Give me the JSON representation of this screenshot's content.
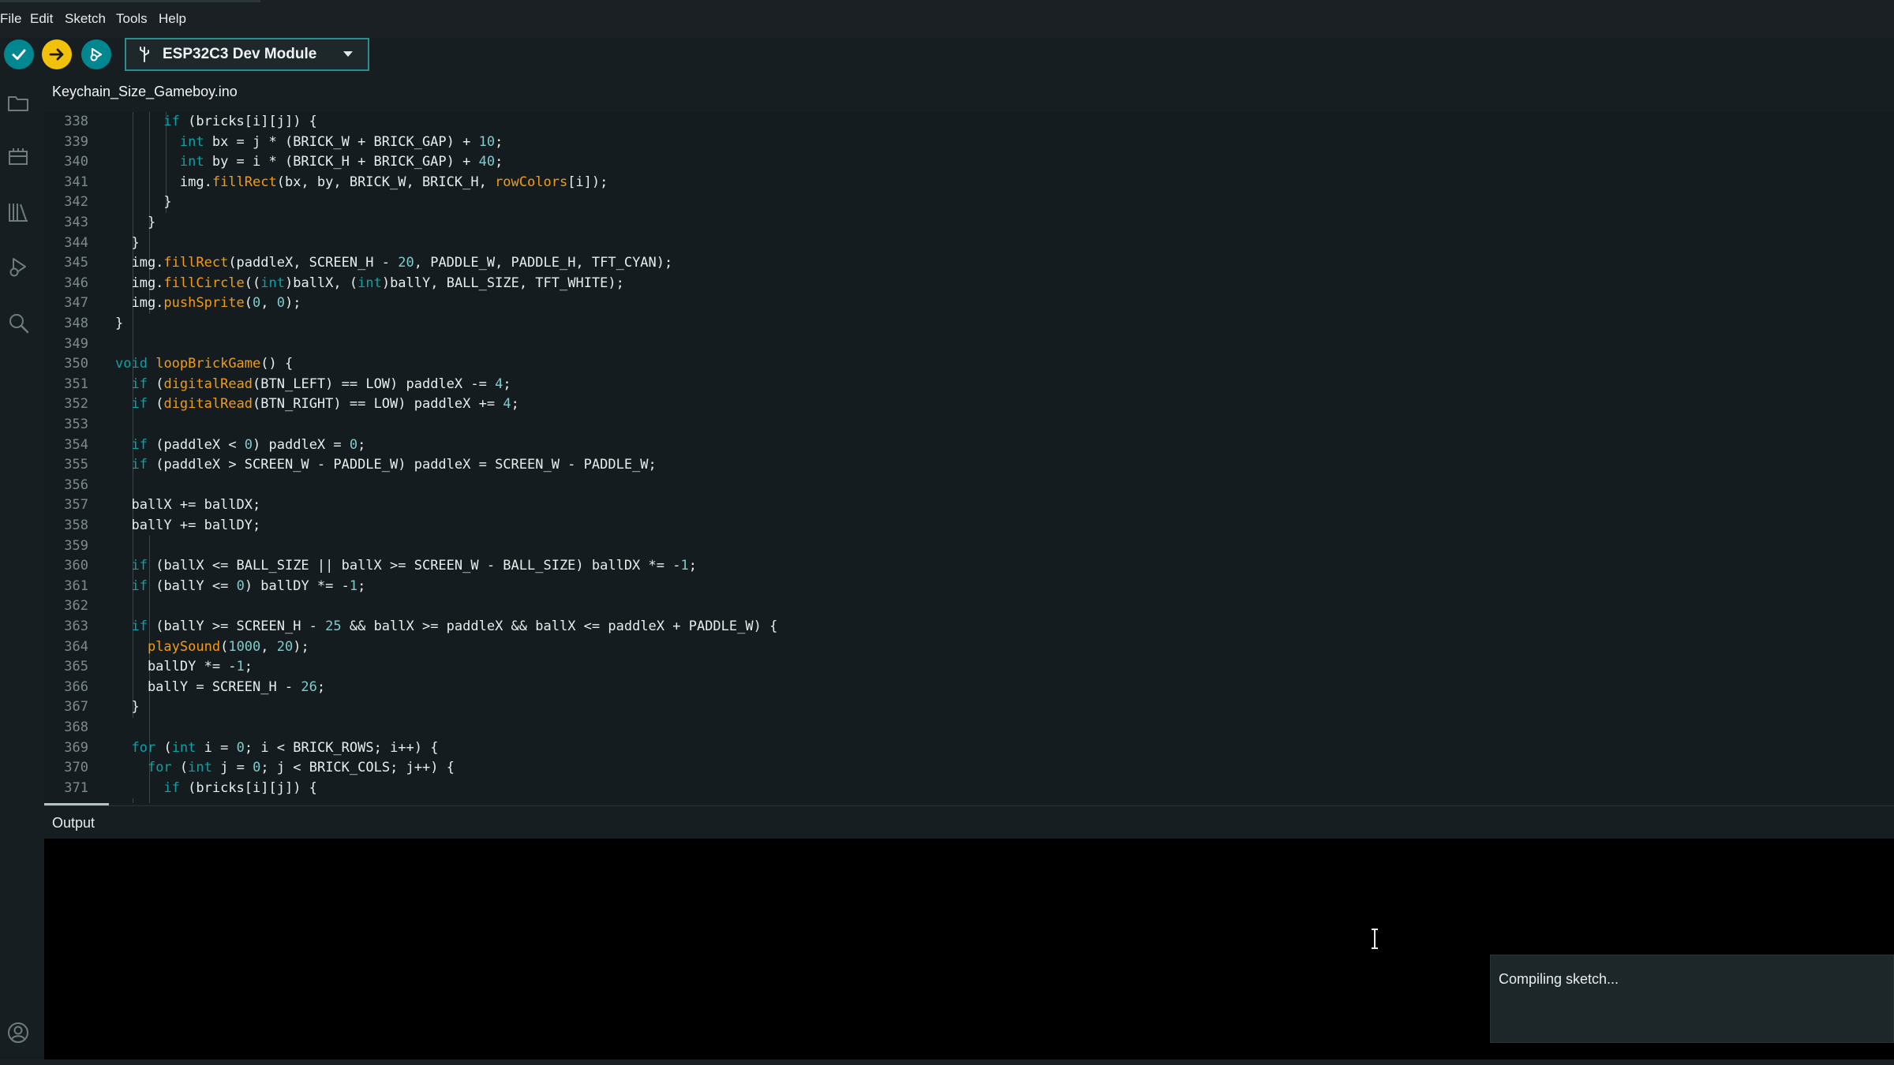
{
  "menu": [
    "File",
    "Edit",
    "Sketch",
    "Tools",
    "Help"
  ],
  "toolbar": {
    "verify_icon": "check-icon",
    "upload_icon": "arrow-right-icon",
    "debug_icon": "debug-icon",
    "board": "ESP32C3 Dev Module"
  },
  "sidebar": [
    "folder-icon",
    "board-icon",
    "library-icon",
    "debug-icon",
    "search-icon",
    "account-icon"
  ],
  "tab": {
    "filename": "Keychain_Size_Gameboy.ino"
  },
  "colors": {
    "keyword": "#0ca1a6",
    "function": "#f39c12",
    "number": "#7fcbcd",
    "text": "#e8eded",
    "accent": "#00878f",
    "upload": "#f2c20a"
  },
  "code": [
    {
      "n": "338",
      "t": [
        [
          "      ",
          "p"
        ],
        [
          "if",
          "k"
        ],
        [
          " (bricks[i][j]) {",
          "p"
        ]
      ]
    },
    {
      "n": "339",
      "t": [
        [
          "        ",
          "p"
        ],
        [
          "int",
          "k"
        ],
        [
          " bx = j * (BRICK_W + BRICK_GAP) + ",
          "p"
        ],
        [
          "10",
          "n"
        ],
        [
          ";",
          "p"
        ]
      ]
    },
    {
      "n": "340",
      "t": [
        [
          "        ",
          "p"
        ],
        [
          "int",
          "k"
        ],
        [
          " by = i * (BRICK_H + BRICK_GAP) + ",
          "p"
        ],
        [
          "40",
          "n"
        ],
        [
          ";",
          "p"
        ]
      ]
    },
    {
      "n": "341",
      "t": [
        [
          "        img.",
          "p"
        ],
        [
          "fillRect",
          "f"
        ],
        [
          "(bx, by, BRICK_W, BRICK_H, ",
          "p"
        ],
        [
          "rowColors",
          "f"
        ],
        [
          "[i]);",
          "p"
        ]
      ]
    },
    {
      "n": "342",
      "t": [
        [
          "      }",
          "p"
        ]
      ]
    },
    {
      "n": "343",
      "t": [
        [
          "    }",
          "p"
        ]
      ]
    },
    {
      "n": "344",
      "t": [
        [
          "  }",
          "p"
        ]
      ]
    },
    {
      "n": "345",
      "t": [
        [
          "  img.",
          "p"
        ],
        [
          "fillRect",
          "f"
        ],
        [
          "(paddleX, SCREEN_H - ",
          "p"
        ],
        [
          "20",
          "n"
        ],
        [
          ", PADDLE_W, PADDLE_H, TFT_CYAN);",
          "p"
        ]
      ]
    },
    {
      "n": "346",
      "t": [
        [
          "  img.",
          "p"
        ],
        [
          "fillCircle",
          "f"
        ],
        [
          "((",
          "p"
        ],
        [
          "int",
          "k"
        ],
        [
          ")ballX, (",
          "p"
        ],
        [
          "int",
          "k"
        ],
        [
          ")ballY, BALL_SIZE, TFT_WHITE);",
          "p"
        ]
      ]
    },
    {
      "n": "347",
      "t": [
        [
          "  img.",
          "p"
        ],
        [
          "pushSprite",
          "f"
        ],
        [
          "(",
          "p"
        ],
        [
          "0",
          "n"
        ],
        [
          ", ",
          "p"
        ],
        [
          "0",
          "n"
        ],
        [
          ");",
          "p"
        ]
      ]
    },
    {
      "n": "348",
      "t": [
        [
          "}",
          "p"
        ]
      ]
    },
    {
      "n": "349",
      "t": []
    },
    {
      "n": "350",
      "t": [
        [
          "void",
          "k"
        ],
        [
          " ",
          "p"
        ],
        [
          "loopBrickGame",
          "f"
        ],
        [
          "() {",
          "p"
        ]
      ]
    },
    {
      "n": "351",
      "t": [
        [
          "  ",
          "p"
        ],
        [
          "if",
          "k"
        ],
        [
          " (",
          "p"
        ],
        [
          "digitalRead",
          "f"
        ],
        [
          "(BTN_LEFT) == LOW) paddleX -= ",
          "p"
        ],
        [
          "4",
          "n"
        ],
        [
          ";",
          "p"
        ]
      ]
    },
    {
      "n": "352",
      "t": [
        [
          "  ",
          "p"
        ],
        [
          "if",
          "k"
        ],
        [
          " (",
          "p"
        ],
        [
          "digitalRead",
          "f"
        ],
        [
          "(BTN_RIGHT) == LOW) paddleX += ",
          "p"
        ],
        [
          "4",
          "n"
        ],
        [
          ";",
          "p"
        ]
      ]
    },
    {
      "n": "353",
      "t": []
    },
    {
      "n": "354",
      "t": [
        [
          "  ",
          "p"
        ],
        [
          "if",
          "k"
        ],
        [
          " (paddleX < ",
          "p"
        ],
        [
          "0",
          "n"
        ],
        [
          ") paddleX = ",
          "p"
        ],
        [
          "0",
          "n"
        ],
        [
          ";",
          "p"
        ]
      ]
    },
    {
      "n": "355",
      "t": [
        [
          "  ",
          "p"
        ],
        [
          "if",
          "k"
        ],
        [
          " (paddleX > SCREEN_W - PADDLE_W) paddleX = SCREEN_W - PADDLE_W;",
          "p"
        ]
      ]
    },
    {
      "n": "356",
      "t": []
    },
    {
      "n": "357",
      "t": [
        [
          "  ballX += ballDX;",
          "p"
        ]
      ]
    },
    {
      "n": "358",
      "t": [
        [
          "  ballY += ballDY;",
          "p"
        ]
      ]
    },
    {
      "n": "359",
      "t": []
    },
    {
      "n": "360",
      "t": [
        [
          "  ",
          "p"
        ],
        [
          "if",
          "k"
        ],
        [
          " (ballX <= BALL_SIZE || ballX >= SCREEN_W - BALL_SIZE) ballDX *= -",
          "p"
        ],
        [
          "1",
          "n"
        ],
        [
          ";",
          "p"
        ]
      ]
    },
    {
      "n": "361",
      "t": [
        [
          "  ",
          "p"
        ],
        [
          "if",
          "k"
        ],
        [
          " (ballY <= ",
          "p"
        ],
        [
          "0",
          "n"
        ],
        [
          ") ballDY *= -",
          "p"
        ],
        [
          "1",
          "n"
        ],
        [
          ";",
          "p"
        ]
      ]
    },
    {
      "n": "362",
      "t": []
    },
    {
      "n": "363",
      "t": [
        [
          "  ",
          "p"
        ],
        [
          "if",
          "k"
        ],
        [
          " (ballY >= SCREEN_H - ",
          "p"
        ],
        [
          "25",
          "n"
        ],
        [
          " && ballX >= paddleX && ballX <= paddleX + PADDLE_W) {",
          "p"
        ]
      ]
    },
    {
      "n": "364",
      "t": [
        [
          "    ",
          "p"
        ],
        [
          "playSound",
          "f"
        ],
        [
          "(",
          "p"
        ],
        [
          "1000",
          "n"
        ],
        [
          ", ",
          "p"
        ],
        [
          "20",
          "n"
        ],
        [
          ");",
          "p"
        ]
      ]
    },
    {
      "n": "365",
      "t": [
        [
          "    ballDY *= -",
          "p"
        ],
        [
          "1",
          "n"
        ],
        [
          ";",
          "p"
        ]
      ]
    },
    {
      "n": "366",
      "t": [
        [
          "    ballY = SCREEN_H - ",
          "p"
        ],
        [
          "26",
          "n"
        ],
        [
          ";",
          "p"
        ]
      ]
    },
    {
      "n": "367",
      "t": [
        [
          "  }",
          "p"
        ]
      ]
    },
    {
      "n": "368",
      "t": []
    },
    {
      "n": "369",
      "t": [
        [
          "  ",
          "p"
        ],
        [
          "for",
          "k"
        ],
        [
          " (",
          "p"
        ],
        [
          "int",
          "k"
        ],
        [
          " i = ",
          "p"
        ],
        [
          "0",
          "n"
        ],
        [
          "; i < BRICK_ROWS; i++) {",
          "p"
        ]
      ]
    },
    {
      "n": "370",
      "t": [
        [
          "    ",
          "p"
        ],
        [
          "for",
          "k"
        ],
        [
          " (",
          "p"
        ],
        [
          "int",
          "k"
        ],
        [
          " j = ",
          "p"
        ],
        [
          "0",
          "n"
        ],
        [
          "; j < BRICK_COLS; j++) {",
          "p"
        ]
      ]
    },
    {
      "n": "371",
      "t": [
        [
          "      ",
          "p"
        ],
        [
          "if",
          "k"
        ],
        [
          " (bricks[i][j]) {",
          "p"
        ]
      ]
    }
  ],
  "output": {
    "label": "Output"
  },
  "notification": {
    "text": "Compiling sketch..."
  }
}
